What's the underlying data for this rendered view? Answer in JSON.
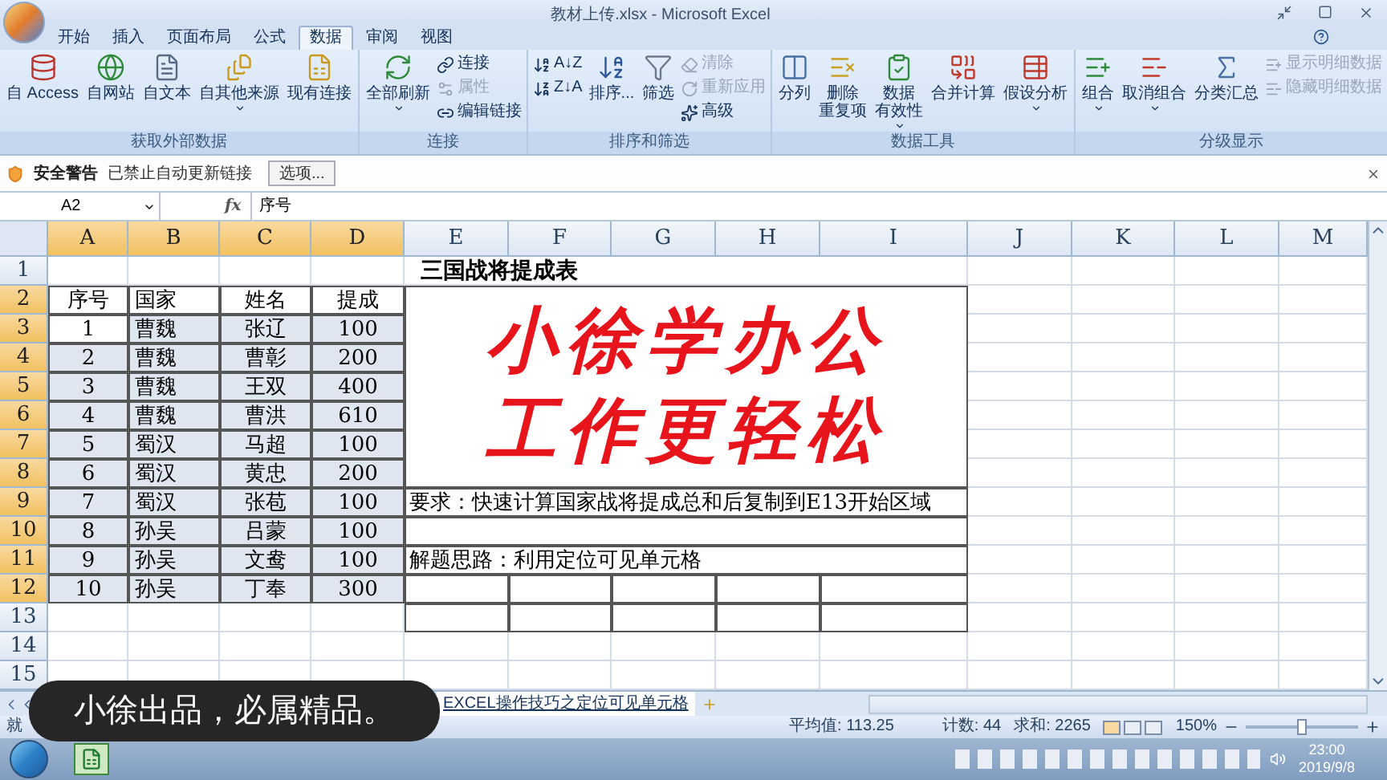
{
  "window": {
    "title": "教材上传.xlsx - Microsoft Excel"
  },
  "tabs": [
    {
      "label": "开始",
      "selected": false
    },
    {
      "label": "插入",
      "selected": false
    },
    {
      "label": "页面布局",
      "selected": false
    },
    {
      "label": "公式",
      "selected": false
    },
    {
      "label": "数据",
      "selected": true
    },
    {
      "label": "审阅",
      "selected": false
    },
    {
      "label": "视图",
      "selected": false
    }
  ],
  "ribbon_groups": [
    {
      "label": "获取外部数据",
      "items": [
        {
          "kind": "large",
          "label": "自 Access",
          "dropdown": false
        },
        {
          "kind": "large",
          "label": "自网站",
          "dropdown": false
        },
        {
          "kind": "large",
          "label": "自文本",
          "dropdown": false
        },
        {
          "kind": "large",
          "label": "自其他来源",
          "dropdown": true
        },
        {
          "kind": "large",
          "label": "现有连接",
          "dropdown": false
        }
      ]
    },
    {
      "label": "连接",
      "items": [
        {
          "kind": "large",
          "label": "全部刷新",
          "dropdown": true
        },
        {
          "kind": "stack",
          "items": [
            {
              "label": "连接",
              "disabled": false
            },
            {
              "label": "属性",
              "disabled": true
            },
            {
              "label": "编辑链接",
              "disabled": false
            }
          ]
        }
      ]
    },
    {
      "label": "排序和筛选",
      "items": [
        {
          "kind": "stack",
          "items": [
            {
              "label": "A↓Z",
              "disabled": false
            },
            {
              "label": "Z↓A",
              "disabled": false
            }
          ]
        },
        {
          "kind": "large",
          "label": "排序...",
          "dropdown": false
        },
        {
          "kind": "large",
          "label": "筛选",
          "dropdown": false
        },
        {
          "kind": "stack",
          "items": [
            {
              "label": "清除",
              "disabled": true
            },
            {
              "label": "重新应用",
              "disabled": true
            },
            {
              "label": "高级",
              "disabled": false
            }
          ]
        }
      ]
    },
    {
      "label": "数据工具",
      "items": [
        {
          "kind": "large",
          "label": "分列",
          "dropdown": false
        },
        {
          "kind": "large",
          "lines": [
            "删除",
            "重复项"
          ],
          "dropdown": false
        },
        {
          "kind": "large",
          "lines": [
            "数据",
            "有效性"
          ],
          "dropdown": true
        },
        {
          "kind": "large",
          "label": "合并计算",
          "dropdown": false
        },
        {
          "kind": "large",
          "label": "假设分析",
          "dropdown": true
        }
      ]
    },
    {
      "label": "分级显示",
      "items": [
        {
          "kind": "large",
          "label": "组合",
          "dropdown": true
        },
        {
          "kind": "large",
          "label": "取消组合",
          "dropdown": true
        },
        {
          "kind": "large",
          "label": "分类汇总",
          "dropdown": false
        },
        {
          "kind": "stack",
          "items": [
            {
              "label": "显示明细数据",
              "disabled": true
            },
            {
              "label": "隐藏明细数据",
              "disabled": true
            }
          ]
        }
      ]
    }
  ],
  "security_bar": {
    "title": "安全警告",
    "message": "已禁止自动更新链接",
    "button": "选项..."
  },
  "formula_bar": {
    "cell_ref": "A2",
    "function_label": "fx",
    "formula": "序号"
  },
  "sheet": {
    "columns": [
      {
        "label": "A",
        "selected": true
      },
      {
        "label": "B",
        "selected": true
      },
      {
        "label": "C",
        "selected": true
      },
      {
        "label": "D",
        "selected": true
      },
      {
        "label": "E",
        "selected": false
      },
      {
        "label": "F",
        "selected": false
      },
      {
        "label": "G",
        "selected": false
      },
      {
        "label": "H",
        "selected": false
      },
      {
        "label": "I",
        "selected": false
      },
      {
        "label": "J",
        "selected": false
      },
      {
        "label": "K",
        "selected": false
      },
      {
        "label": "L",
        "selected": false
      },
      {
        "label": "M",
        "selected": false
      }
    ],
    "rows": [
      {
        "label": "1",
        "selected": false
      },
      {
        "label": "2",
        "selected": true
      },
      {
        "label": "3",
        "selected": true
      },
      {
        "label": "4",
        "selected": true
      },
      {
        "label": "5",
        "selected": true
      },
      {
        "label": "6",
        "selected": true
      },
      {
        "label": "7",
        "selected": true
      },
      {
        "label": "8",
        "selected": true
      },
      {
        "label": "9",
        "selected": true
      },
      {
        "label": "10",
        "selected": true
      },
      {
        "label": "11",
        "selected": true
      },
      {
        "label": "12",
        "selected": true
      },
      {
        "label": "13",
        "selected": false
      },
      {
        "label": "14",
        "selected": false
      },
      {
        "label": "15",
        "selected": false
      }
    ],
    "title": "三国战将提成表",
    "table": {
      "headers": [
        "序号",
        "国家",
        "姓名",
        "提成"
      ],
      "rows": [
        [
          "1",
          "曹魏",
          "张辽",
          "100"
        ],
        [
          "2",
          "曹魏",
          "曹彰",
          "200"
        ],
        [
          "3",
          "曹魏",
          "王双",
          "400"
        ],
        [
          "4",
          "曹魏",
          "曹洪",
          "610"
        ],
        [
          "5",
          "蜀汉",
          "马超",
          "100"
        ],
        [
          "6",
          "蜀汉",
          "黄忠",
          "200"
        ],
        [
          "7",
          "蜀汉",
          "张苞",
          "100"
        ],
        [
          "8",
          "孙吴",
          "吕蒙",
          "100"
        ],
        [
          "9",
          "孙吴",
          "文鸯",
          "100"
        ],
        [
          "10",
          "孙吴",
          "丁奉",
          "300"
        ]
      ]
    },
    "banner": [
      "小徐学办公",
      "工作更轻松"
    ],
    "notes": [
      "要求：快速计算国家战将提成总和后复制到E13开始区域",
      "解题思路：利用定位可见单元格"
    ]
  },
  "sheet_tabs": [
    {
      "label": "EXCEL操作技巧之定位可见单元格",
      "selected": true
    }
  ],
  "caption": "小徐出品，必属精品。",
  "status_bar": {
    "status": "就",
    "average": "平均值: 113.25",
    "count": "计数: 44",
    "sum": "求和: 2265",
    "zoom": "150%",
    "zoom_slider": {
      "level": 0.5
    }
  },
  "taskbar": {
    "time": "23:00",
    "date": "2019/9/8"
  }
}
